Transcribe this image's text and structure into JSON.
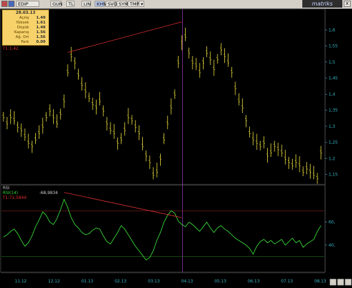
{
  "toolbar": {
    "buttons": [
      "EDIP",
      "GUN",
      "TL",
      "LIN",
      "KHN",
      "SVD",
      "SYM",
      "TMP"
    ],
    "brand": "matriks",
    "close": "x"
  },
  "infobox": {
    "date": "28.03.13",
    "rows": [
      {
        "label": "Açılış",
        "value": "1.49"
      },
      {
        "label": "Yüksek",
        "value": "1.61"
      },
      {
        "label": "Düşük",
        "value": "1.48"
      },
      {
        "label": "Kapanış",
        "value": "1.56"
      },
      {
        "label": "Ağ. Ort",
        "value": "1.56"
      },
      {
        "label": "Fark",
        "value": "0.09"
      }
    ]
  },
  "price_overlay": "T1:1,42",
  "rsi_panel": {
    "title": "RSI",
    "value_label": "RSI(14)",
    "value": ":68,9834",
    "trend_label": "T1:72,5844"
  },
  "colors": {
    "price": "#d8cc38",
    "rsi": "#38d838",
    "trend": "#e03030",
    "axis": "#38b8c8",
    "cursor": "#a040c0"
  },
  "chart_data": [
    {
      "type": "line",
      "title": "",
      "series": [
        {
          "values": [
            1.33,
            1.31,
            1.33,
            1.32,
            1.3,
            1.29,
            1.27,
            1.25,
            1.24,
            1.26,
            1.28,
            1.3,
            1.33,
            1.35,
            1.33,
            1.31,
            1.34,
            1.38,
            1.47,
            1.52,
            1.5,
            1.46,
            1.43,
            1.41,
            1.39,
            1.37,
            1.36,
            1.38,
            1.35,
            1.31,
            1.29,
            1.28,
            1.25,
            1.26,
            1.29,
            1.33,
            1.32,
            1.3,
            1.28,
            1.24,
            1.21,
            1.19,
            1.15,
            1.16,
            1.2,
            1.26,
            1.31,
            1.36,
            1.4,
            1.5,
            1.56,
            1.58,
            1.53,
            1.5,
            1.49,
            1.47,
            1.5,
            1.53,
            1.51,
            1.48,
            1.51,
            1.54,
            1.52,
            1.5,
            1.47,
            1.42,
            1.38,
            1.36,
            1.32,
            1.28,
            1.26,
            1.25,
            1.24,
            1.25,
            1.21,
            1.22,
            1.24,
            1.23,
            1.22,
            1.2,
            1.19,
            1.18,
            1.19,
            1.18,
            1.16,
            1.17,
            1.16,
            1.15,
            1.14,
            1.22
          ]
        }
      ],
      "y_ticks": [
        "1,6",
        "1,55",
        "1,5",
        "1,45",
        "1,4",
        "1,35",
        "1,3",
        "1,25",
        "1,2",
        "1,15"
      ],
      "ylim": [
        1.13,
        1.65
      ]
    },
    {
      "type": "line",
      "title": "",
      "series": [
        {
          "values": [
            47,
            49,
            52,
            54,
            50,
            44,
            39,
            42,
            48,
            56,
            62,
            69,
            66,
            60,
            58,
            63,
            71,
            80,
            73,
            64,
            58,
            55,
            51,
            49,
            50,
            53,
            55,
            54,
            48,
            43,
            41,
            46,
            51,
            57,
            54,
            49,
            44,
            39,
            35,
            31,
            27,
            29,
            35,
            44,
            51,
            60,
            66,
            70,
            68,
            61,
            58,
            56,
            60,
            58,
            55,
            52,
            56,
            60,
            55,
            51,
            55,
            57,
            54,
            52,
            49,
            46,
            44,
            42,
            40,
            37,
            32,
            39,
            43,
            45,
            42,
            44,
            41,
            43,
            45,
            40,
            43,
            46,
            42,
            44,
            38,
            41,
            43,
            45,
            52,
            57
          ]
        }
      ],
      "y_ticks": [
        "60,",
        "40,"
      ],
      "ylim": [
        20,
        90
      ]
    }
  ],
  "x_axis": {
    "labels": [
      "11.12",
      "12.12",
      "01.13",
      "02.13",
      "03.13",
      "04.13",
      "05.13",
      "06.13",
      "07.13",
      "08.13"
    ]
  }
}
